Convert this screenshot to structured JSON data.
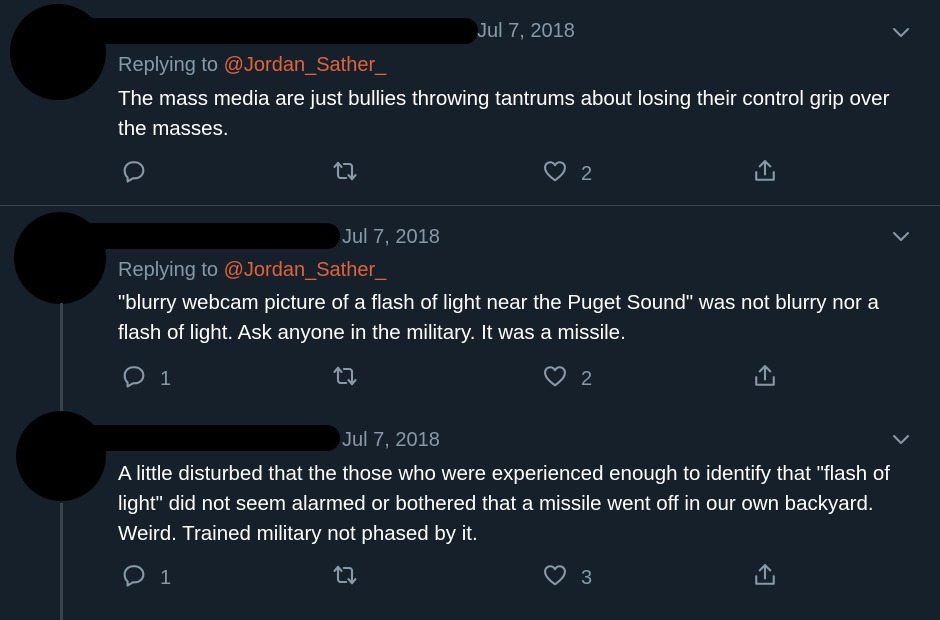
{
  "tweets": [
    {
      "date": "Jul 7, 2018",
      "replying_prefix": "Replying to ",
      "replying_handle": "@Jordan_Sather_",
      "text": "The mass media are just bullies throwing tantrums about losing their control grip over the masses.",
      "actions": {
        "reply_count": "",
        "retweet_count": "",
        "like_count": "2"
      },
      "icons": [
        "reply-icon",
        "retweet-icon",
        "heart-icon",
        "share-icon",
        "chevron-down-icon"
      ]
    },
    {
      "date": "Jul 7, 2018",
      "replying_prefix": "Replying to ",
      "replying_handle": "@Jordan_Sather_",
      "text": "\"blurry webcam picture of a flash of light near the Puget Sound\" was not blurry nor a flash of light.  Ask anyone in the military.  It was a missile.",
      "actions": {
        "reply_count": "1",
        "retweet_count": "",
        "like_count": "2"
      },
      "icons": [
        "reply-icon",
        "retweet-icon",
        "heart-icon",
        "share-icon",
        "chevron-down-icon"
      ]
    },
    {
      "date": "Jul 7, 2018",
      "text": "A little disturbed that the those who were experienced enough to identify that \"flash of light\" did not seem alarmed or bothered that a missile went off in our own backyard.  Weird.  Trained military not phased by it.",
      "actions": {
        "reply_count": "1",
        "retweet_count": "",
        "like_count": "3"
      },
      "icons": [
        "reply-icon",
        "retweet-icon",
        "heart-icon",
        "share-icon",
        "chevron-down-icon"
      ]
    }
  ],
  "colors": {
    "background": "#15202b",
    "text": "#ffffff",
    "muted": "#8899a6",
    "handle_link": "#e0633b",
    "divider": "#38444d"
  }
}
